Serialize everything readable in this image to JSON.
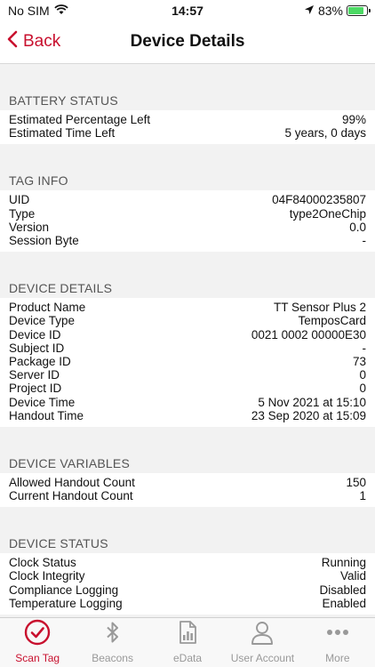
{
  "status_bar": {
    "carrier": "No SIM",
    "time": "14:57",
    "battery": "83%",
    "battery_level": 0.83
  },
  "nav": {
    "back_label": "Back",
    "title": "Device Details"
  },
  "sections": [
    {
      "title": "BATTERY STATUS",
      "rows": [
        {
          "label": "Estimated Percentage Left",
          "value": "99%"
        },
        {
          "label": "Estimated Time Left",
          "value": "5 years, 0 days"
        }
      ]
    },
    {
      "title": "TAG INFO",
      "rows": [
        {
          "label": "UID",
          "value": "04F84000235807"
        },
        {
          "label": "Type",
          "value": "type2OneChip"
        },
        {
          "label": "Version",
          "value": "0.0"
        },
        {
          "label": "Session Byte",
          "value": "-"
        }
      ]
    },
    {
      "title": "DEVICE DETAILS",
      "rows": [
        {
          "label": "Product Name",
          "value": "TT Sensor Plus 2"
        },
        {
          "label": "Device Type",
          "value": "TemposCard"
        },
        {
          "label": "Device ID",
          "value": "0021 0002 00000E30"
        },
        {
          "label": "Subject ID",
          "value": "-"
        },
        {
          "label": "Package ID",
          "value": "73"
        },
        {
          "label": "Server ID",
          "value": "0"
        },
        {
          "label": "Project ID",
          "value": "0"
        },
        {
          "label": "Device Time",
          "value": "5 Nov 2021 at 15:10"
        },
        {
          "label": "Handout Time",
          "value": "23 Sep 2020 at 15:09"
        }
      ]
    },
    {
      "title": "DEVICE VARIABLES",
      "rows": [
        {
          "label": "Allowed Handout Count",
          "value": "150"
        },
        {
          "label": "Current Handout Count",
          "value": "1"
        }
      ]
    },
    {
      "title": "DEVICE STATUS",
      "rows": [
        {
          "label": "Clock Status",
          "value": "Running"
        },
        {
          "label": "Clock Integrity",
          "value": "Valid"
        },
        {
          "label": "Compliance Logging",
          "value": "Disabled"
        },
        {
          "label": "Temperature Logging",
          "value": "Enabled"
        }
      ]
    }
  ],
  "tabs": [
    {
      "label": "Scan Tag",
      "icon": "check-circle-icon",
      "active": true
    },
    {
      "label": "Beacons",
      "icon": "bluetooth-icon",
      "active": false
    },
    {
      "label": "eData",
      "icon": "document-chart-icon",
      "active": false
    },
    {
      "label": "User Account",
      "icon": "person-icon",
      "active": false
    },
    {
      "label": "More",
      "icon": "more-dots-icon",
      "active": false
    }
  ],
  "colors": {
    "accent": "#c8102e",
    "battery": "#4cd964",
    "inactive_tab": "#999999"
  }
}
